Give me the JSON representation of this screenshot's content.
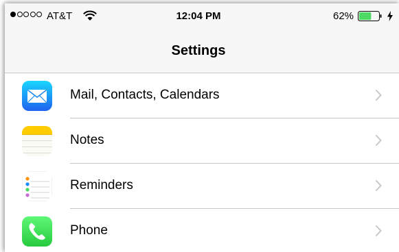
{
  "status_bar": {
    "signal_bars_filled": 1,
    "signal_bars_total": 5,
    "carrier": "AT&T",
    "time": "12:04 PM",
    "battery_percent": "62%",
    "battery_level": 0.62,
    "battery_color": "#4cd964",
    "icons": [
      "wifi-icon",
      "battery-icon",
      "charging-bolt-icon"
    ]
  },
  "nav": {
    "title": "Settings"
  },
  "settings_list": [
    {
      "label": "Mail, Contacts, Calendars",
      "icon": "mail-icon",
      "icon_color": "#1a8cff"
    },
    {
      "label": "Notes",
      "icon": "notes-icon",
      "icon_color": "#ffcc00"
    },
    {
      "label": "Reminders",
      "icon": "reminders-icon",
      "icon_color": "#ffffff"
    },
    {
      "label": "Phone",
      "icon": "phone-icon",
      "icon_color": "#4cd964"
    }
  ]
}
